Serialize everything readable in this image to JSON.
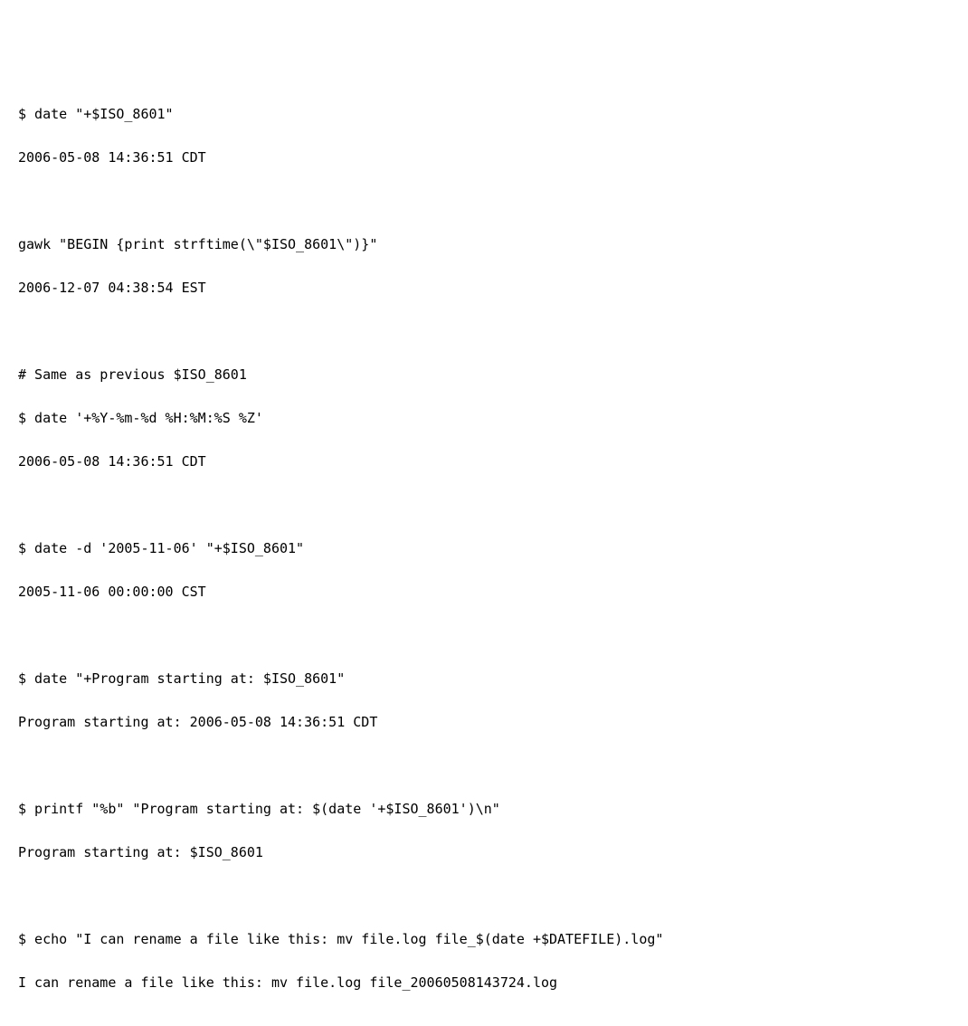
{
  "lines": [
    "$ date \"+$ISO_8601\"",
    "2006-05-08 14:36:51 CDT",
    "",
    "gawk \"BEGIN {print strftime(\\\"$ISO_8601\\\")}\"",
    "2006-12-07 04:38:54 EST",
    "",
    "# Same as previous $ISO_8601",
    "$ date '+%Y-%m-%d %H:%M:%S %Z'",
    "2006-05-08 14:36:51 CDT",
    "",
    "$ date -d '2005-11-06' \"+$ISO_8601\"",
    "2005-11-06 00:00:00 CST",
    "",
    "$ date \"+Program starting at: $ISO_8601\"",
    "Program starting at: 2006-05-08 14:36:51 CDT",
    "",
    "$ printf \"%b\" \"Program starting at: $(date '+$ISO_8601')\\n\"",
    "Program starting at: $ISO_8601",
    "",
    "$ echo \"I can rename a file like this: mv file.log file_$(date +$DATEFILE).log\"",
    "I can rename a file like this: mv file.log file_20060508143724.log"
  ]
}
